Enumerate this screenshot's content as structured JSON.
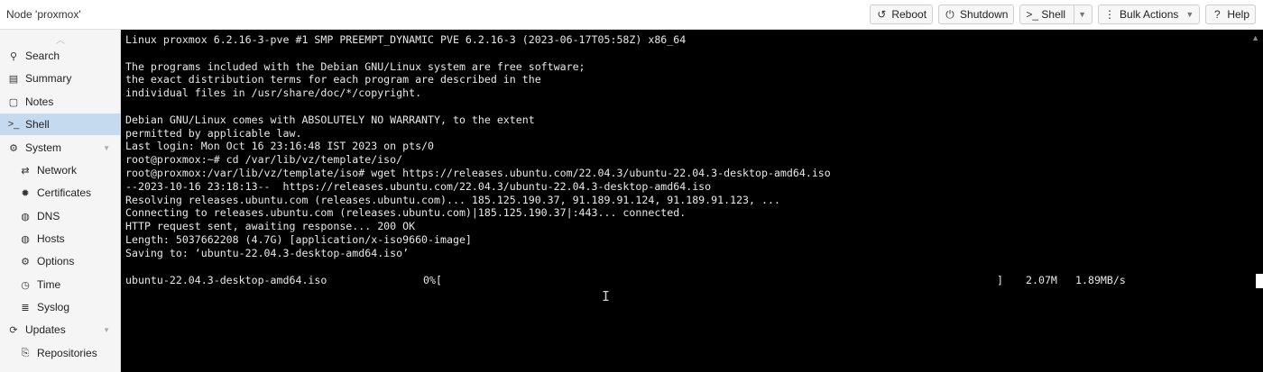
{
  "header": {
    "title": "Node 'proxmox'",
    "buttons": {
      "reboot": "Reboot",
      "shutdown": "Shutdown",
      "shell": "Shell",
      "bulk_actions": "Bulk Actions",
      "help": "Help"
    }
  },
  "sidebar": {
    "items": [
      {
        "label": "Search",
        "icon": "search-icon"
      },
      {
        "label": "Summary",
        "icon": "summary-icon"
      },
      {
        "label": "Notes",
        "icon": "notes-icon"
      },
      {
        "label": "Shell",
        "icon": "terminal-icon",
        "active": true
      },
      {
        "label": "System",
        "icon": "gears-icon",
        "expandable": true
      },
      {
        "label": "Network",
        "icon": "network-icon"
      },
      {
        "label": "Certificates",
        "icon": "certificate-icon"
      },
      {
        "label": "DNS",
        "icon": "globe-icon"
      },
      {
        "label": "Hosts",
        "icon": "globe-icon"
      },
      {
        "label": "Options",
        "icon": "gear-icon"
      },
      {
        "label": "Time",
        "icon": "clock-icon"
      },
      {
        "label": "Syslog",
        "icon": "list-icon"
      },
      {
        "label": "Updates",
        "icon": "refresh-icon",
        "expandable": true
      },
      {
        "label": "Repositories",
        "icon": "repository-icon"
      }
    ]
  },
  "terminal": {
    "output": "Linux proxmox 6.2.16-3-pve #1 SMP PREEMPT_DYNAMIC PVE 6.2.16-3 (2023-06-17T05:58Z) x86_64\n\nThe programs included with the Debian GNU/Linux system are free software;\nthe exact distribution terms for each program are described in the\nindividual files in /usr/share/doc/*/copyright.\n\nDebian GNU/Linux comes with ABSOLUTELY NO WARRANTY, to the extent\npermitted by applicable law.\nLast login: Mon Oct 16 23:16:48 IST 2023 on pts/0\nroot@proxmox:~# cd /var/lib/vz/template/iso/\nroot@proxmox:/var/lib/vz/template/iso# wget https://releases.ubuntu.com/22.04.3/ubuntu-22.04.3-desktop-amd64.iso\n--2023-10-16 23:18:13--  https://releases.ubuntu.com/22.04.3/ubuntu-22.04.3-desktop-amd64.iso\nResolving releases.ubuntu.com (releases.ubuntu.com)... 185.125.190.37, 91.189.91.124, 91.189.91.123, ...\nConnecting to releases.ubuntu.com (releases.ubuntu.com)|185.125.190.37|:443... connected.\nHTTP request sent, awaiting response... 200 OK\nLength: 5037662208 (4.7G) [application/x-iso9660-image]\nSaving to: ‘ubuntu-22.04.3-desktop-amd64.iso’",
    "progress": {
      "filename": "ubuntu-22.04.3-desktop-amd64.iso",
      "percent": "0%[",
      "bar_end": "]",
      "downloaded": "2.07M",
      "speed": "1.89MB/s"
    }
  }
}
